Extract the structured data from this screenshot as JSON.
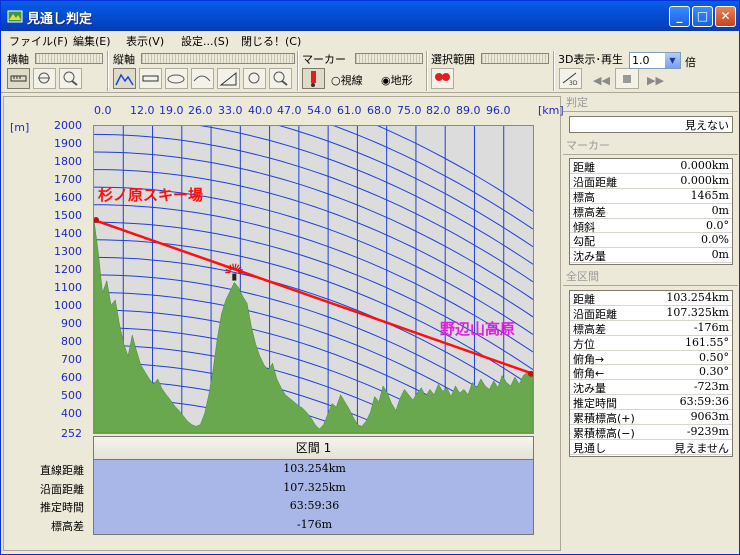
{
  "window": {
    "title": "見通し判定"
  },
  "menu": [
    "ファイル(F)",
    "編集(E)",
    "表示(V)",
    "設定...(S)",
    "閉じる！(C)"
  ],
  "toolbar": {
    "horizontal_label": "横軸",
    "vertical_label": "縦軸",
    "marker_label": "マーカー",
    "selection_label": "選択範囲",
    "view3d_label": "3D表示･再生",
    "speed_value": "1.0",
    "speed_unit": "倍",
    "radio_sight": "視線",
    "radio_terrain": "地形",
    "btn3d_text": "3D"
  },
  "chart_data": {
    "type": "area",
    "xunit": "[km]",
    "yunit": "[m]",
    "x_ticks": [
      "0.0",
      "12.0",
      "19.0",
      "26.0",
      "33.0",
      "40.0",
      "47.0",
      "54.0",
      "61.0",
      "68.0",
      "75.0",
      "82.0",
      "89.0",
      "96.0"
    ],
    "y_ticks": [
      "2000",
      "1900",
      "1800",
      "1700",
      "1600",
      "1500",
      "1400",
      "1300",
      "1200",
      "1100",
      "1000",
      "900",
      "800",
      "700",
      "600",
      "500",
      "400",
      "252"
    ],
    "ylim": [
      252,
      2000
    ],
    "xlim": [
      0,
      103.254
    ],
    "sight_line": {
      "start": [
        0,
        1465
      ],
      "end": [
        103.254,
        589
      ]
    },
    "start_label": "杉ノ原スキー場",
    "end_label": "野辺山高原",
    "profile_x": [
      0,
      1,
      2,
      3,
      4,
      5,
      6,
      7,
      8,
      9,
      10,
      11,
      12,
      13,
      14,
      15,
      16,
      17,
      18,
      19,
      20,
      21,
      22,
      23,
      24,
      25,
      26,
      27,
      28,
      29,
      30,
      31,
      32,
      33,
      34,
      35,
      36,
      37,
      38,
      39,
      40,
      41,
      42,
      43,
      44,
      45,
      46,
      47,
      48,
      49,
      50,
      51,
      52,
      53,
      54,
      55,
      56,
      57,
      58,
      59,
      60,
      61,
      62,
      63,
      64,
      65,
      66,
      67,
      68,
      69,
      70,
      71,
      72,
      73,
      74,
      75,
      76,
      77,
      78,
      79,
      80,
      81,
      82,
      83,
      84,
      85,
      86,
      87,
      88,
      89,
      90,
      91,
      92,
      93,
      94,
      95,
      96,
      97,
      98,
      99,
      100,
      101,
      102,
      103.254
    ],
    "profile_y": [
      1465,
      1280,
      1050,
      1120,
      980,
      1010,
      870,
      760,
      690,
      810,
      720,
      640,
      600,
      560,
      530,
      560,
      505,
      470,
      440,
      405,
      380,
      350,
      320,
      300,
      290,
      300,
      360,
      470,
      610,
      790,
      930,
      1010,
      1060,
      1110,
      1080,
      1030,
      990,
      860,
      760,
      690,
      640,
      610,
      650,
      560,
      510,
      470,
      450,
      430,
      410,
      395,
      370,
      340,
      300,
      275,
      300,
      360,
      420,
      400,
      470,
      430,
      390,
      340,
      300,
      290,
      320,
      370,
      460,
      430,
      520,
      480,
      420,
      380,
      450,
      500,
      470,
      440,
      480,
      510,
      460,
      500,
      470,
      530,
      490,
      510,
      460,
      520,
      480,
      500,
      470,
      540,
      510,
      560,
      520,
      500,
      550,
      510,
      580,
      540,
      520,
      570,
      530,
      580,
      600,
      589
    ]
  },
  "section": {
    "header": "区間 1",
    "rows": [
      {
        "label": "直線距離",
        "value": "103.254km"
      },
      {
        "label": "沿面距離",
        "value": "107.325km"
      },
      {
        "label": "推定時間",
        "value": "63:59:36"
      },
      {
        "label": "標高差",
        "value": "-176m"
      }
    ]
  },
  "side": {
    "judgement_title": "判定",
    "judgement_value": "見えない",
    "marker_title": "マーカー",
    "marker_rows": [
      {
        "k": "距離",
        "v": "0.000km"
      },
      {
        "k": "沿面距離",
        "v": "0.000km"
      },
      {
        "k": "標高",
        "v": "1465m"
      },
      {
        "k": "標高差",
        "v": "0m"
      },
      {
        "k": "傾斜",
        "v": "0.0°"
      },
      {
        "k": "勾配",
        "v": "0.0%"
      },
      {
        "k": "沈み量",
        "v": "0m"
      }
    ],
    "all_title": "全区間",
    "all_rows": [
      {
        "k": "距離",
        "v": "103.254km"
      },
      {
        "k": "沿面距離",
        "v": "107.325km"
      },
      {
        "k": "標高差",
        "v": "-176m"
      },
      {
        "k": "方位",
        "v": "161.55°"
      },
      {
        "k": "俯角→",
        "v": "0.50°"
      },
      {
        "k": "俯角←",
        "v": "0.30°"
      },
      {
        "k": "沈み量",
        "v": "-723m"
      },
      {
        "k": "推定時間",
        "v": "63:59:36"
      },
      {
        "k": "累積標高(+)",
        "v": "9063m"
      },
      {
        "k": "累積標高(−)",
        "v": "-9239m"
      },
      {
        "k": "見通し",
        "v": "見えません"
      }
    ]
  }
}
